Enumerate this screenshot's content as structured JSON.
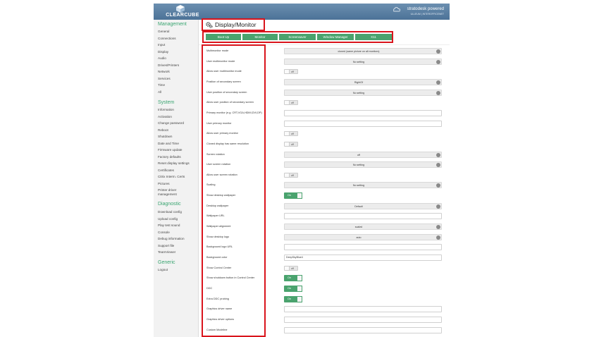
{
  "header": {
    "logo_text": "CLEARCUBE",
    "brand_line1": "stratodesk powered",
    "brand_line2": "ULLEUM | INTEROFFICENET"
  },
  "sidebar": {
    "sections": [
      {
        "title": "Management",
        "items": [
          "General",
          "Connections",
          "Input",
          "Display",
          "Audio",
          "Drives/Printers",
          "Network",
          "Services",
          "Time",
          "All"
        ]
      },
      {
        "title": "System",
        "items": [
          "Information",
          "Activation",
          "Change password",
          "Reboot",
          "Shutdown",
          "Date and Time",
          "Firmware update",
          "Factory defaults",
          "Reset display settings",
          "Certificates",
          "Citrix Interm. Certs",
          "Pictures",
          "Printer driver",
          "management"
        ]
      },
      {
        "title": "Diagnostic",
        "items": [
          "Download config",
          "Upload config",
          "Play test sound",
          "Console",
          "Debug information",
          "Support file",
          "TeamViewer"
        ]
      },
      {
        "title": "Generic",
        "items": [
          "Logout"
        ]
      }
    ]
  },
  "page": {
    "title": "Display/Monitor",
    "tabs": [
      "Boot Up",
      "Monitor",
      "Screensaver",
      "Window Manager",
      "X11"
    ]
  },
  "rows": [
    {
      "label": "Multimonitor mode",
      "type": "select",
      "value": "cloned (same picture on all monitors)"
    },
    {
      "label": "User multimonitor mode",
      "type": "select",
      "value": "No setting"
    },
    {
      "label": "Allow user multimonitor mode",
      "type": "toggle",
      "value": "off"
    },
    {
      "label": "Position of secondary screen",
      "type": "select",
      "value": "RightOf"
    },
    {
      "label": "User position of secondary screen",
      "type": "select",
      "value": "No setting"
    },
    {
      "label": "Allow user position of secondary screen",
      "type": "toggle",
      "value": "off"
    },
    {
      "label": "Primary monitor (e.g. CRT,VGA,HDMI,DVI,DP)",
      "type": "input",
      "value": ""
    },
    {
      "label": "User primary monitor",
      "type": "input",
      "value": ""
    },
    {
      "label": "Allow user primary monitor",
      "type": "toggle",
      "value": "off"
    },
    {
      "label": "Cloned display has same resolution",
      "type": "toggle",
      "value": "off"
    },
    {
      "label": "Screen rotation",
      "type": "select",
      "value": "off"
    },
    {
      "label": "User screen rotation",
      "type": "select",
      "value": "No setting"
    },
    {
      "label": "Allow user screen rotation",
      "type": "toggle",
      "value": "off"
    },
    {
      "label": "Scaling",
      "type": "select",
      "value": "No setting"
    },
    {
      "label": "Show desktop wallpaper",
      "type": "toggle",
      "value": "On"
    },
    {
      "label": "Desktop wallpaper",
      "type": "select",
      "value": "Default"
    },
    {
      "label": "Wallpaper URL",
      "type": "input",
      "value": ""
    },
    {
      "label": "Wallpaper alignment",
      "type": "select",
      "value": "scaled"
    },
    {
      "label": "Show desktop logo",
      "type": "select",
      "value": "auto"
    },
    {
      "label": "Background logo URL",
      "type": "input",
      "value": ""
    },
    {
      "label": "Background color",
      "type": "input",
      "value": "DeepSkyBlue4"
    },
    {
      "label": "Show Control Center",
      "type": "toggle",
      "value": "off"
    },
    {
      "label": "Show shutdown button in Control Center",
      "type": "toggle",
      "value": "On"
    },
    {
      "label": "DDC",
      "type": "toggle",
      "value": "On"
    },
    {
      "label": "Extra DDC probing",
      "type": "toggle",
      "value": "On"
    },
    {
      "label": "Graphics driver name",
      "type": "input",
      "value": ""
    },
    {
      "label": "Graphics driver options",
      "type": "input",
      "value": ""
    },
    {
      "label": "Custom Modeline",
      "type": "input",
      "value": ""
    }
  ],
  "colors": {
    "accent": "#4aa36e",
    "highlight": "#d9141c",
    "header": "#5a7fa3"
  }
}
